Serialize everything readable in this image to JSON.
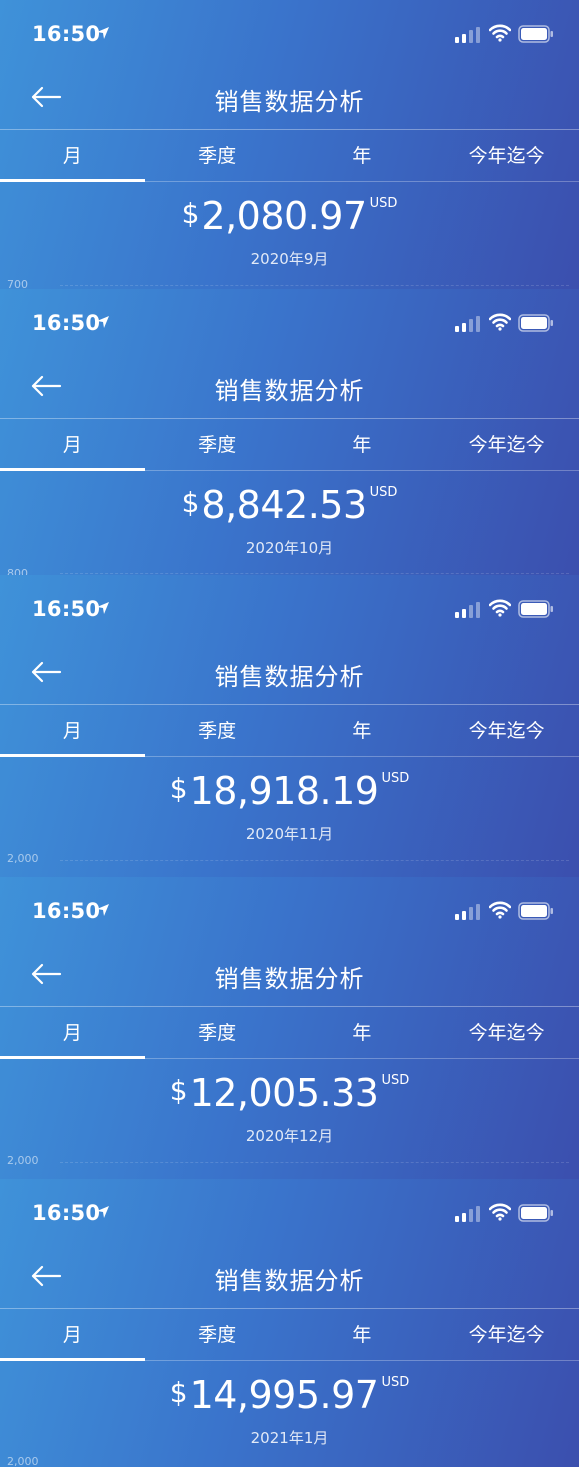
{
  "status_bar": {
    "time": "16:50",
    "location_icon": "location-arrow-icon",
    "signal_icon": "cellular-signal-icon",
    "wifi_icon": "wifi-icon",
    "battery_icon": "battery-icon"
  },
  "nav": {
    "back_icon": "arrow-left-icon",
    "title": "销售数据分析"
  },
  "tabs": [
    "月",
    "季度",
    "年",
    "今年迄今"
  ],
  "active_tab": "月",
  "screens": [
    {
      "amount": "2,080.97",
      "currency_symbol": "$",
      "currency_code": "USD",
      "period": "2020年9月",
      "axis_label": "700"
    },
    {
      "amount": "8,842.53",
      "currency_symbol": "$",
      "currency_code": "USD",
      "period": "2020年10月",
      "axis_label": "800"
    },
    {
      "amount": "18,918.19",
      "currency_symbol": "$",
      "currency_code": "USD",
      "period": "2020年11月",
      "axis_label": "2,000"
    },
    {
      "amount": "12,005.33",
      "currency_symbol": "$",
      "currency_code": "USD",
      "period": "2020年12月",
      "axis_label": "2,000"
    },
    {
      "amount": "14,995.97",
      "currency_symbol": "$",
      "currency_code": "USD",
      "period": "2021年1月",
      "axis_label": "2,000"
    }
  ],
  "colors": {
    "gradient_left": "#3f92d9",
    "gradient_mid": "#3a73cb",
    "gradient_right": "#3b4fae",
    "text": "#ffffff"
  }
}
